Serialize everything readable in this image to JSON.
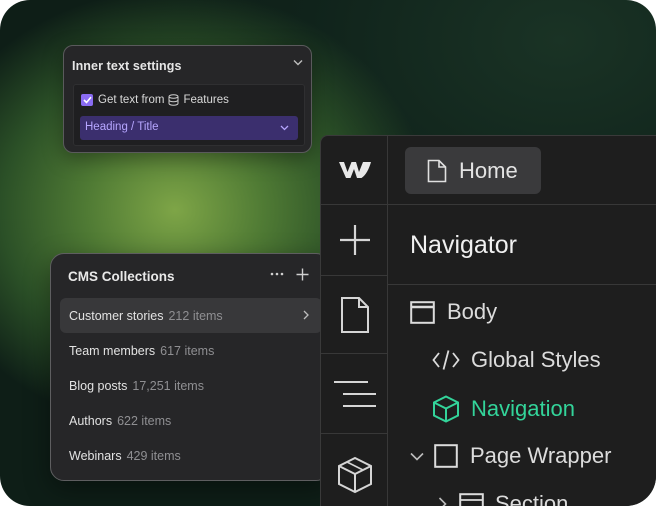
{
  "inner_text_settings": {
    "title": "Inner text settings",
    "checkbox_label": "Get text from",
    "source_collection": "Features",
    "checked": true,
    "selected_field": "Heading / Title"
  },
  "cms_collections": {
    "title": "CMS Collections",
    "items": [
      {
        "name": "Customer stories",
        "count": "212 items",
        "active": true
      },
      {
        "name": "Team members",
        "count": "617 items"
      },
      {
        "name": "Blog posts",
        "count": "17,251 items"
      },
      {
        "name": "Authors",
        "count": "622 items"
      },
      {
        "name": "Webinars",
        "count": "429 items"
      }
    ]
  },
  "designer": {
    "logo": "webflow-logo",
    "page_button": "Home",
    "panel_title": "Navigator",
    "rail_icons": [
      "webflow-logo",
      "add-icon",
      "page-icon",
      "navigator-icon",
      "components-icon"
    ],
    "tree": [
      {
        "label": "Body",
        "icon": "body-icon"
      },
      {
        "label": "Global Styles",
        "icon": "code-icon"
      },
      {
        "label": "Navigation",
        "icon": "component-icon",
        "selected": true
      },
      {
        "label": "Page Wrapper",
        "icon": "div-block-icon",
        "expanded": true
      },
      {
        "label": "Section",
        "icon": "section-icon"
      }
    ]
  },
  "colors": {
    "accent_purple": "#8a6cf3",
    "select_bg": "#3b2f6e",
    "selected_green": "#33d49a"
  }
}
